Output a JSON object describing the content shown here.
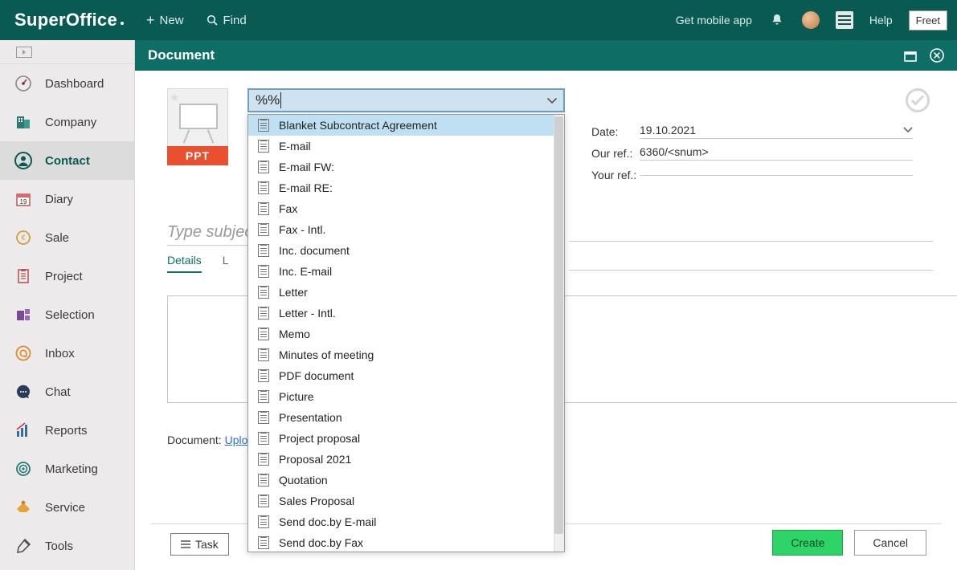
{
  "brand": "SuperOffice",
  "topbar": {
    "new_label": "New",
    "find_label": "Find",
    "mobile_label": "Get mobile app",
    "help_label": "Help",
    "freetext": "Freet"
  },
  "sidebar": {
    "items": [
      {
        "label": "Dashboard"
      },
      {
        "label": "Company"
      },
      {
        "label": "Contact"
      },
      {
        "label": "Diary"
      },
      {
        "label": "Sale"
      },
      {
        "label": "Project"
      },
      {
        "label": "Selection"
      },
      {
        "label": "Inbox"
      },
      {
        "label": "Chat"
      },
      {
        "label": "Reports"
      },
      {
        "label": "Marketing"
      },
      {
        "label": "Service"
      },
      {
        "label": "Tools"
      }
    ],
    "active_index": 2
  },
  "doc": {
    "title": "Document",
    "ppt_badge": "PPT",
    "combo_value": "%%",
    "subject_placeholder": "Type subject",
    "tabs": [
      "Details",
      "L"
    ],
    "document_label": "Document:",
    "upload_label": "Uplo",
    "task_label": "Task",
    "create_label": "Create",
    "cancel_label": "Cancel"
  },
  "fields": {
    "date_label": "Date:",
    "date_value": "19.10.2021",
    "ourref_label": "Our ref.:",
    "ourref_value": "6360/<snum>",
    "yourref_label": "Your ref.:",
    "yourref_value": ""
  },
  "dropdown": {
    "highlight_index": 0,
    "items": [
      "Blanket Subcontract Agreement",
      "E-mail",
      "E-mail FW:",
      "E-mail RE:",
      "Fax",
      "Fax - Intl.",
      "Inc. document",
      "Inc. E-mail",
      "Letter",
      "Letter - Intl.",
      "Memo",
      "Minutes of meeting",
      "PDF document",
      "Picture",
      "Presentation",
      "Project proposal",
      "Proposal 2021",
      "Quotation",
      "Sales Proposal",
      "Send doc.by E-mail",
      "Send doc.by Fax"
    ]
  }
}
